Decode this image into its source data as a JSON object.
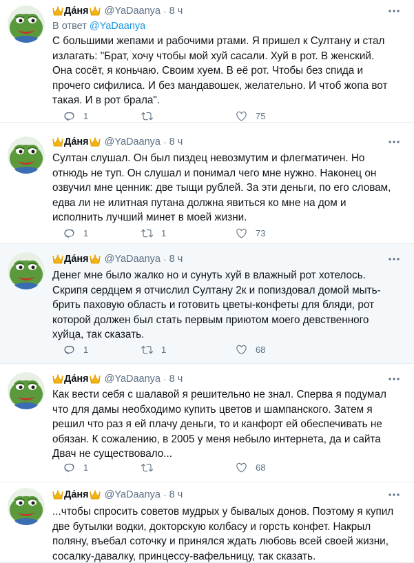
{
  "author": {
    "name": "Да́ня",
    "handle": "@YaDaanya",
    "time": "8 ч",
    "dot": "·"
  },
  "colors": {
    "text": "#0f1419",
    "secondary": "#5b7083",
    "link": "#1b95e0",
    "highlight_bg": "#f5f8fa",
    "divider": "#e6ecf0"
  },
  "reply_to": {
    "prefix": "В ответ",
    "mention": "@YaDaanya"
  },
  "tweets": [
    {
      "text": "С большими жепами и рабочими ртами. Я пришел к Султану и стал излагать: \"Брат, хочу чтобы мой хуй сасали. Хуй в рот. В женский. Она сосёт, я коньчаю. Своим хуем. В её рот. Чтобы без спида и прочего сифилиса. И без мандавошек, желательно. И чтоб жопа вот такая. И в рот брала\".",
      "replies": "1",
      "retweets": "",
      "likes": "75"
    },
    {
      "text": "Султан слушал. Он был пиздец невозмутим и флегматичен. Но отнюдь не туп. Он слушал и понимал чего мне нужно. Наконец он озвучил мне ценник: две тыщи рублей. За эти деньги, по его словам, едва ли не илитная путана должна явиться ко мне на дом и исполнить лучший минет в моей жизни.",
      "replies": "1",
      "retweets": "1",
      "likes": "73"
    },
    {
      "text": "Денег мне было жалко но и сунуть хуй в влажный рот хотелось. Скрипя сердцем я отчислил Султану 2к и попиздовал домой мыть-брить паховую область и готовить цветы-конфеты для бляди, рот которой должен был стать первым приютом моего девственного хуйца, так сказать.",
      "replies": "1",
      "retweets": "1",
      "likes": "68"
    },
    {
      "text": "Как вести себя с шалавой я решительно не знал. Сперва я подумал что для дамы необходимо купить цветов и шампанского. Затем я решил что раз я ей плачу деньги, то и канфорт ей обеспечивать не обязан. К сожалению, в 2005 у меня небыло интернета, да и сайта Двач не существовало...",
      "replies": "1",
      "retweets": "",
      "likes": "68"
    },
    {
      "text": "...чтобы спросить советов мудрых у бывалых донов. Поэтому я купил две бутылки водки, докторскую колбасу и горсть конфет. Накрыл поляну, въебал соточку и принялся ждать любовь всей своей жизни, сосалку-давалку, принцессу-вафельницу, так сказать.",
      "replies": "",
      "retweets": "",
      "likes": ""
    }
  ]
}
